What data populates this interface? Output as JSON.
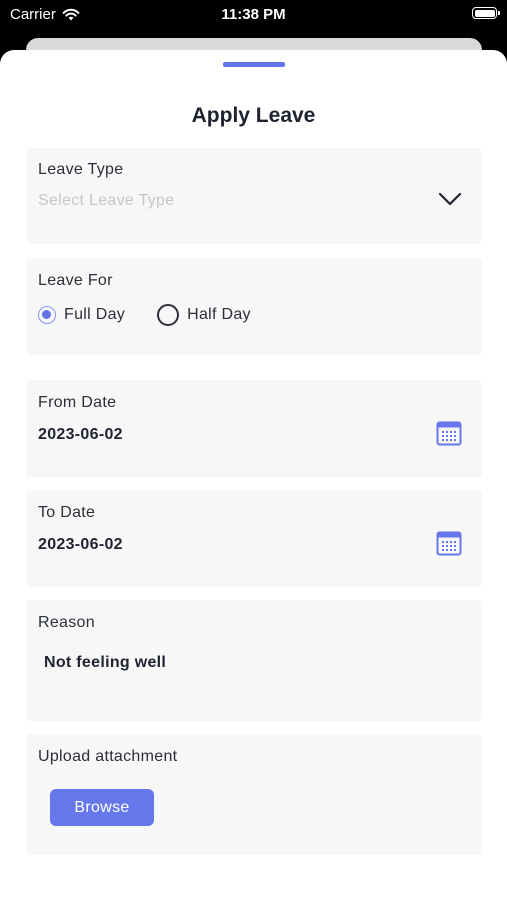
{
  "status_bar": {
    "carrier": "Carrier",
    "time": "11:38 PM"
  },
  "sheet": {
    "title": "Apply Leave"
  },
  "leave_type": {
    "label": "Leave Type",
    "placeholder": "Select Leave Type"
  },
  "leave_for": {
    "label": "Leave For",
    "options": [
      {
        "label": "Full Day",
        "selected": true
      },
      {
        "label": "Half Day",
        "selected": false
      }
    ]
  },
  "from_date": {
    "label": "From Date",
    "value": "2023-06-02"
  },
  "to_date": {
    "label": "To Date",
    "value": "2023-06-02"
  },
  "reason": {
    "label": "Reason",
    "value": "Not feeling well"
  },
  "attachment": {
    "label": "Upload attachment",
    "button_label": "Browse"
  },
  "colors": {
    "accent": "#6677ec",
    "card_bg": "#f7f7f8",
    "placeholder": "#c3c6cc"
  },
  "icons": [
    "wifi-icon",
    "battery-icon",
    "chevron-down-icon",
    "calendar-icon"
  ]
}
